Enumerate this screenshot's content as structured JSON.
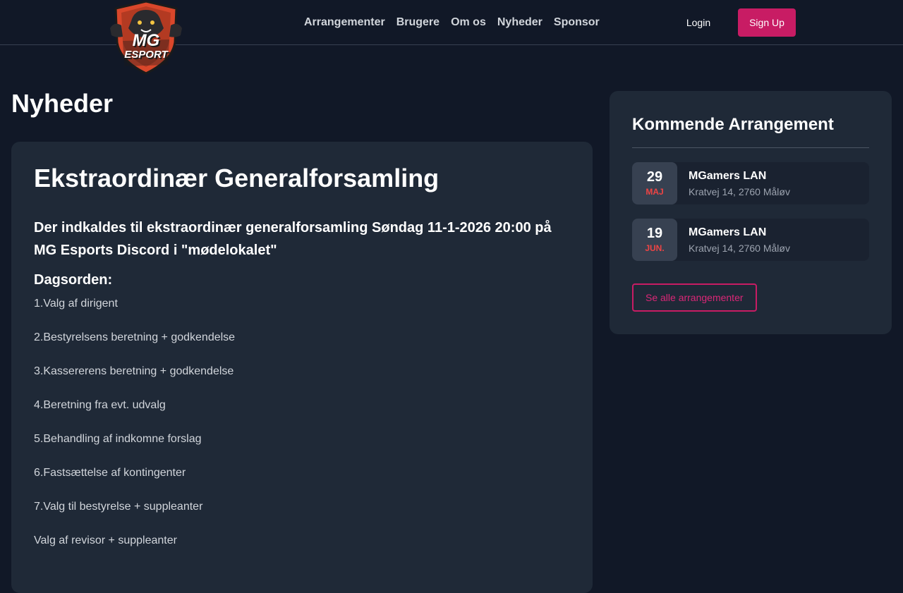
{
  "brand": {
    "logo_text_top": "MG",
    "logo_text_bottom": "ESPORT"
  },
  "nav": {
    "items": [
      {
        "label": "Arrangementer"
      },
      {
        "label": "Brugere"
      },
      {
        "label": "Om os"
      },
      {
        "label": "Nyheder"
      },
      {
        "label": "Sponsor"
      }
    ],
    "login_label": "Login",
    "signup_label": "Sign Up"
  },
  "page": {
    "title": "Nyheder"
  },
  "article": {
    "title": "Ekstraordinær Generalforsamling",
    "lead": "Der indkaldes til ekstraordinær generalforsamling Søndag 11-1-2026 20:00 på MG Esports Discord i \"mødelokalet\"",
    "agenda_heading": "Dagsorden:",
    "agenda": [
      "1.Valg af dirigent",
      "2.Bestyrelsens beretning + godkendelse",
      "3.Kassererens beretning + godkendelse",
      "4.Beretning fra evt. udvalg",
      "5.Behandling af indkomne forslag",
      "6.Fastsættelse af kontingenter",
      "7.Valg til bestyrelse + suppleanter",
      "Valg af revisor + suppleanter"
    ]
  },
  "sidebar": {
    "title": "Kommende Arrangement",
    "events": [
      {
        "day": "29",
        "month": "MAJ",
        "name": "MGamers LAN",
        "address": "Kratvej 14, 2760 Måløv"
      },
      {
        "day": "19",
        "month": "JUN.",
        "name": "MGamers LAN",
        "address": "Kratvej 14, 2760 Måløv"
      }
    ],
    "see_all_label": "Se alle arrangementer"
  },
  "colors": {
    "background": "#111827",
    "card": "#1f2937",
    "accent": "#c81c64",
    "month": "#ef4444"
  }
}
